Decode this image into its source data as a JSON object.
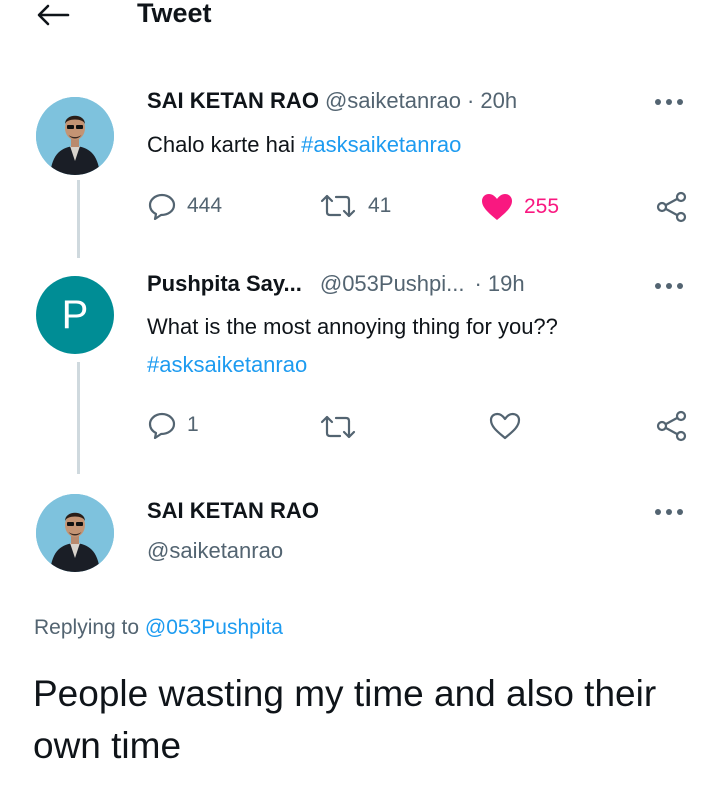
{
  "header": {
    "title": "Tweet",
    "back_icon": "arrow-left-icon"
  },
  "tweet1": {
    "author_name": "SAI KETAN RAO",
    "author_handle": "@saiketanrao",
    "separator": "·",
    "time": "20h",
    "text": "Chalo karte hai ",
    "hashtag": "#asksaiketanrao",
    "replies": "444",
    "retweets": "41",
    "likes": "255",
    "liked": true,
    "like_color": "#f91880"
  },
  "tweet2": {
    "avatar_letter": "P",
    "avatar_color": "#008d95",
    "author_name": "Pushpita Say...",
    "author_handle": "@053Pushpi...",
    "separator": "·",
    "time": "19h",
    "text": "What is the most annoying thing for you??",
    "hashtag": "#asksaiketanrao",
    "replies": "1"
  },
  "main_tweet": {
    "author_name": "SAI KETAN RAO",
    "author_handle": "@saiketanrao",
    "replying_prefix": "Replying to ",
    "replying_to": "@053Pushpita",
    "text": "People wasting my time and also their own time"
  },
  "colors": {
    "accent": "#1d9bf0",
    "muted": "#536471",
    "thread_line": "#cfd9de"
  }
}
